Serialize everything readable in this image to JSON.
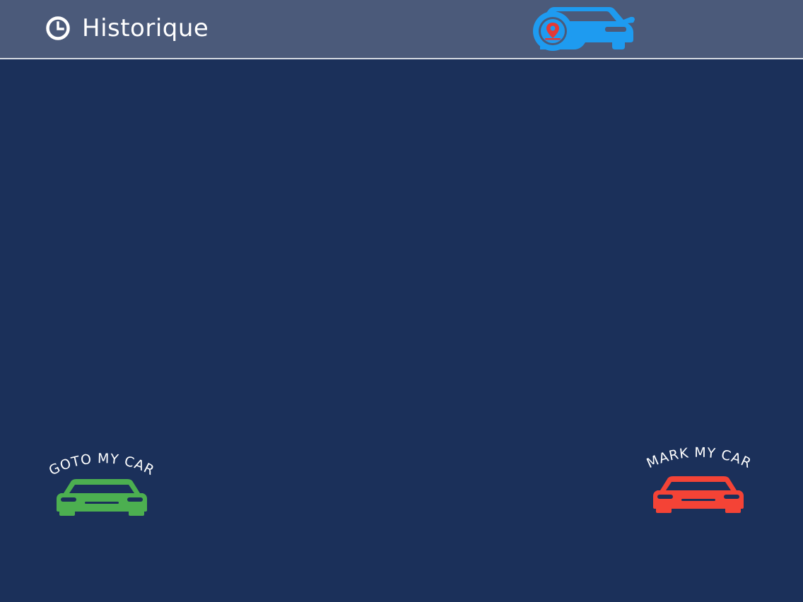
{
  "header": {
    "history_label": "Historique",
    "history_icon": "clock-icon",
    "locate_icon": "car-location-icon"
  },
  "actions": {
    "goto": {
      "label": "GOTO MY CAR",
      "icon": "car-icon",
      "color": "#4caf50"
    },
    "mark": {
      "label": "MARK MY CAR",
      "icon": "car-icon",
      "color": "#f44336"
    }
  },
  "colors": {
    "header_bg": "#4b5a7a",
    "page_bg": "#1b305a",
    "accent_blue": "#1e9bf0",
    "pin_red": "#e53935"
  }
}
